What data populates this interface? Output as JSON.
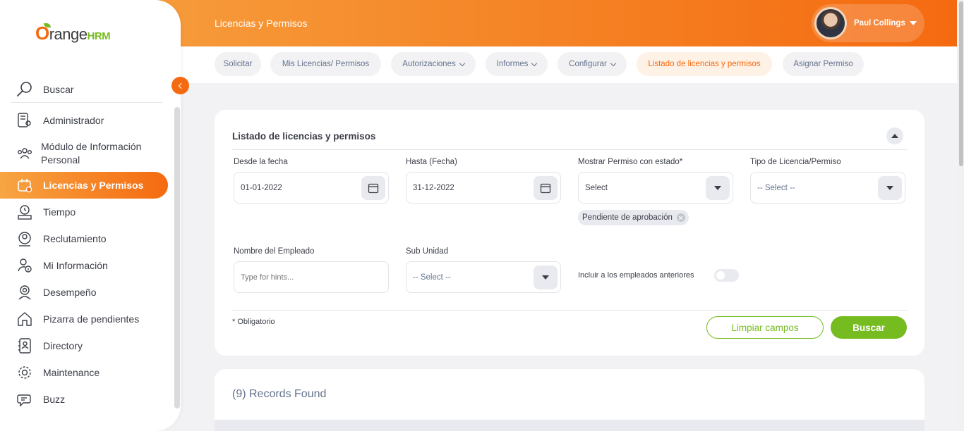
{
  "header": {
    "title": "Licencias y Permisos",
    "user_name": "Paul Collings"
  },
  "logo": {
    "o": "O",
    "range": "range",
    "hrm": "HRM"
  },
  "sidebar": {
    "search_label": "Buscar",
    "items": [
      {
        "label": "Administrador",
        "icon": "admin-icon"
      },
      {
        "label": "Módulo de Información Personal",
        "icon": "pim-icon"
      },
      {
        "label": "Licencias y Permisos",
        "icon": "leave-icon",
        "active": true
      },
      {
        "label": "Tiempo",
        "icon": "time-icon"
      },
      {
        "label": "Reclutamiento",
        "icon": "recruitment-icon"
      },
      {
        "label": "Mi Información",
        "icon": "my-info-icon"
      },
      {
        "label": "Desempeño",
        "icon": "performance-icon"
      },
      {
        "label": "Pizarra de pendientes",
        "icon": "dashboard-icon"
      },
      {
        "label": "Directory",
        "icon": "directory-icon"
      },
      {
        "label": "Maintenance",
        "icon": "maintenance-icon"
      },
      {
        "label": "Buzz",
        "icon": "buzz-icon"
      }
    ]
  },
  "tabs": [
    {
      "label": "Solicitar"
    },
    {
      "label": "Mis Licencias/ Permisos"
    },
    {
      "label": "Autorizaciones",
      "dropdown": true
    },
    {
      "label": "Informes",
      "dropdown": true
    },
    {
      "label": "Configurar",
      "dropdown": true
    },
    {
      "label": "Listado de licencias y permisos",
      "active": true
    },
    {
      "label": "Asignar Permiso"
    }
  ],
  "filter": {
    "title": "Listado de licencias y permisos",
    "from_label": "Desde la fecha",
    "from_value": "01-01-2022",
    "to_label": "Hasta (Fecha)",
    "to_value": "31-12-2022",
    "status_label": "Mostrar Permiso con estado*",
    "status_value": "Select",
    "status_chip": "Pendiente de aprobación",
    "type_label": "Tipo de Licencia/Permiso",
    "type_value": "-- Select --",
    "employee_label": "Nombre del Empleado",
    "employee_placeholder": "Type for hints...",
    "subunit_label": "Sub Unidad",
    "subunit_value": "-- Select --",
    "past_employees_label": "Incluir a los empleados anteriores",
    "required_note": "* Obligatorio",
    "reset_label": "Limpiar campos",
    "search_label": "Buscar"
  },
  "results": {
    "records_text": "(9) Records Found"
  },
  "colors": {
    "brand_orange": "#f56a10",
    "brand_green": "#76bc21"
  }
}
